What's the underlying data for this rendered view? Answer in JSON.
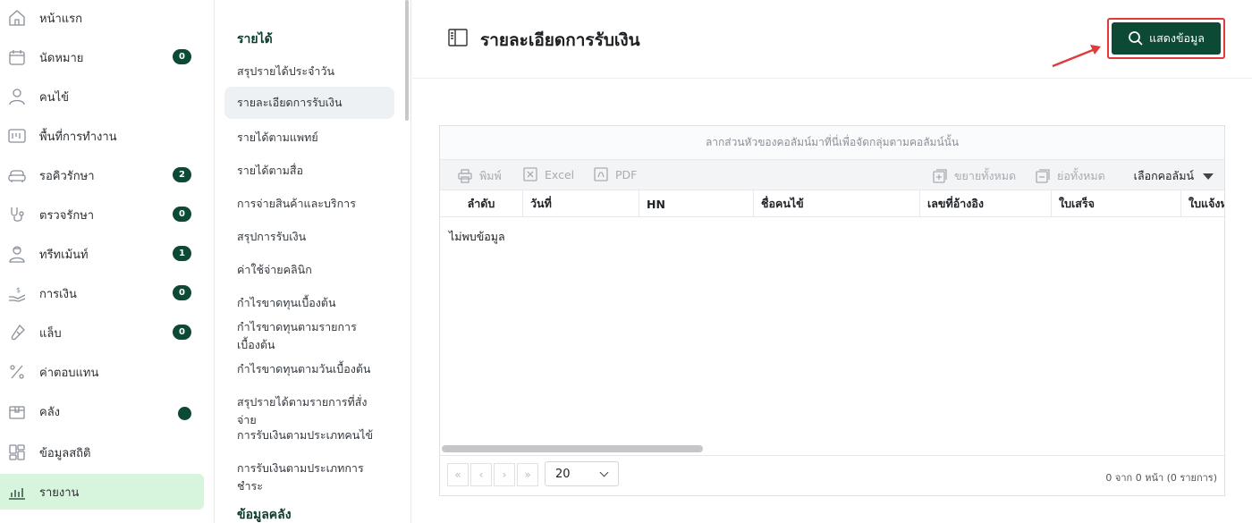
{
  "nav": {
    "items": [
      {
        "label": "หน้าแรก",
        "icon": "home-icon"
      },
      {
        "label": "นัดหมาย",
        "icon": "calendar-icon",
        "badge": "0"
      },
      {
        "label": "คนไข้",
        "icon": "user-icon"
      },
      {
        "label": "พื้นที่การทำงาน",
        "icon": "workspace-icon"
      },
      {
        "label": "รอคิวรักษา",
        "icon": "sofa-icon",
        "badge": "2"
      },
      {
        "label": "ตรวจรักษา",
        "icon": "stethoscope-icon",
        "badge": "0"
      },
      {
        "label": "ทรีทเม้นท์",
        "icon": "doctor-icon",
        "badge": "1"
      },
      {
        "label": "การเงิน",
        "icon": "money-hand-icon",
        "badge": "0"
      },
      {
        "label": "แล็บ",
        "icon": "test-tube-icon",
        "badge": "0"
      },
      {
        "label": "ค่าตอบแทน",
        "icon": "percent-icon"
      },
      {
        "label": "คลัง",
        "icon": "box-icon",
        "dot": true
      },
      {
        "label": "ข้อมูลสถิติ",
        "icon": "dashboard-icon"
      },
      {
        "label": "รายงาน",
        "icon": "bar-chart-icon",
        "active": true
      }
    ]
  },
  "submenu": {
    "section1": "รายได้",
    "items": [
      "สรุปรายได้ประจำวัน",
      "รายละเอียดการรับเงิน",
      "รายได้ตามแพทย์",
      "รายได้ตามสื่อ",
      "การจ่ายสินค้าและบริการ",
      "สรุปการรับเงิน",
      "ค่าใช้จ่ายคลินิก",
      "กำไรขาดทุนเบื้องต้น",
      "กำไรขาดทุนตามรายการเบื้องต้น",
      "กำไรขาดทุนตามวันเบื้องต้น",
      "สรุปรายได้ตามรายการที่สั่งจ่าย",
      "การรับเงินตามประเภทคนไข้",
      "การรับเงินตามประเภทการชำระ"
    ],
    "section2": "ข้อมูลคลัง"
  },
  "header": {
    "title": "รายละเอียดการรับเงิน",
    "show_button": "แสดงข้อมูล"
  },
  "grid": {
    "group_hint": "ลากส่วนหัวของคอลัมน์มาที่นี่เพื่อจัดกลุ่มตามคอลัมน์นั้น",
    "toolbar": {
      "print": "พิมพ์",
      "excel": "Excel",
      "pdf": "PDF",
      "expand_all": "ขยายทั้งหมด",
      "collapse_all": "ย่อทั้งหมด",
      "column_chooser": "เลือกคอลัมน์"
    },
    "columns": [
      "ลำดับ",
      "วันที่",
      "HN",
      "ชื่อคนไข้",
      "เลขที่อ้างอิง",
      "ใบเสร็จ",
      "ใบแจ้งหนี้"
    ],
    "empty_text": "ไม่พบข้อมูล",
    "pager": {
      "first": "«",
      "prev": "‹",
      "next": "›",
      "last": "»",
      "page_size": "20",
      "info": "0 จาก 0 หน้า (0 รายการ)"
    }
  },
  "colors": {
    "primary": "#0d4a36",
    "active_nav": "#d6f5dc",
    "highlight": "#e03a3a"
  }
}
